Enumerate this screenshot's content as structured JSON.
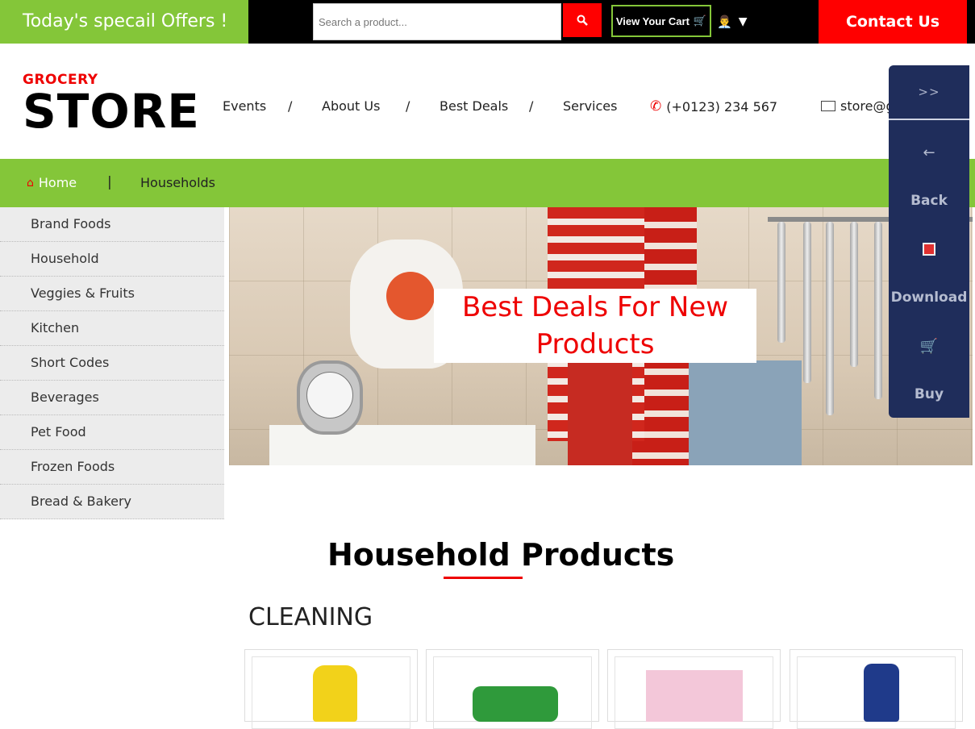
{
  "topbar": {
    "offers": "Today's specail Offers !",
    "search_placeholder": "Search a product...",
    "search_icon": "magnifier-icon",
    "cart_label": "View Your Cart",
    "cart_icon": "🛒",
    "user_icon": "👨‍💼",
    "caret": "▼",
    "contact": "Contact Us"
  },
  "header": {
    "logo_small": "GROCERY",
    "logo_big": "STORE",
    "nav": [
      "Events",
      "About Us",
      "Best Deals",
      "Services"
    ],
    "nav_sep": "/",
    "phone": "(+0123) 234 567",
    "email": "store@g"
  },
  "breadcrumb": {
    "home": "Home",
    "sep": "|",
    "current": "Households"
  },
  "sidebar": {
    "items": [
      "Brand Foods",
      "Household",
      "Veggies & Fruits",
      "Kitchen",
      "Short Codes",
      "Beverages",
      "Pet Food",
      "Frozen Foods",
      "Bread & Bakery"
    ]
  },
  "banner": {
    "label_line1": "Best Deals For New",
    "label_line2": "Products"
  },
  "side_panel": {
    "toggle": ">>",
    "back_icon": "←",
    "back": "Back",
    "download": "Download",
    "buy_icon": "🛒",
    "buy": "Buy"
  },
  "main": {
    "section_title": "Household Products",
    "category": "CLEANING"
  },
  "colors": {
    "green": "#84c639",
    "red": "#ff0000",
    "navy": "#1f2d5b"
  }
}
